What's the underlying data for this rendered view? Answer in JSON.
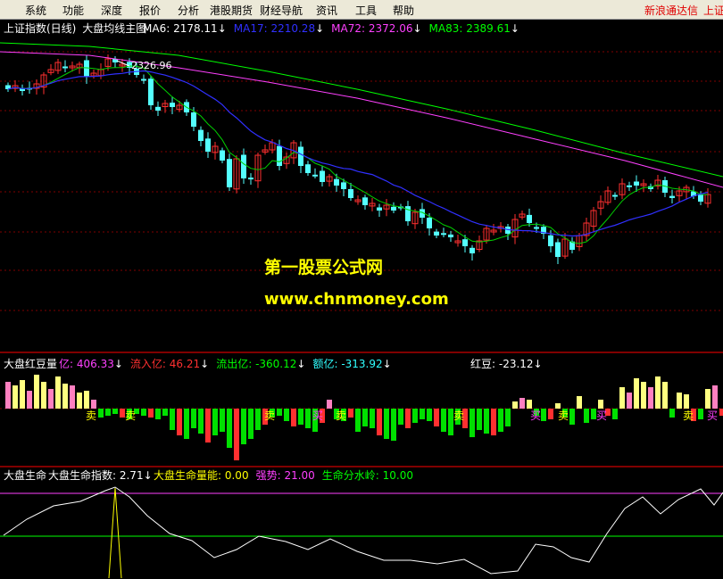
{
  "menu": {
    "items": [
      "系统",
      "功能",
      "深度",
      "报价",
      "分析",
      "港股期货",
      "财经导航",
      "资讯",
      "工具",
      "帮助"
    ],
    "brand": "新浪通达信",
    "brand_cut": "上证"
  },
  "main_panel": {
    "index_name": "上证指数(日线)",
    "formula_name": "大盘均线主图",
    "ma": [
      {
        "label": "MA6: ",
        "value": "2178.11",
        "color": "#ffffff"
      },
      {
        "label": "MA17: ",
        "value": "2210.28",
        "color": "#3030ff"
      },
      {
        "label": "MA72: ",
        "value": "2372.06",
        "color": "#ff40ff"
      },
      {
        "label": "MA83: ",
        "value": "2389.61",
        "color": "#00ff00"
      }
    ],
    "high_marker": "2326.96",
    "watermark_title": "第一股票公式网",
    "watermark_url": "www.chnmoney.com"
  },
  "mid_panel": {
    "name": "大盘红豆量",
    "items": [
      {
        "label": "亿: ",
        "value": "406.33",
        "color": "#ff40ff"
      },
      {
        "label": "流入亿: ",
        "value": "46.21",
        "color": "#ff3030"
      },
      {
        "label": "流出亿: ",
        "value": "-360.12",
        "color": "#00ff00"
      },
      {
        "label": "额亿: ",
        "value": "-313.92",
        "color": "#30ffff"
      },
      {
        "label": "红豆: ",
        "value": "-23.12",
        "color": "#ffffff"
      }
    ],
    "buy_label": "买",
    "sell_label": "卖"
  },
  "bottom_panel": {
    "name": "大盘生命",
    "items": [
      {
        "label": "大盘生命指数: ",
        "value": "2.71",
        "color": "#ffffff"
      },
      {
        "label": "大盘生命量能: ",
        "value": "0.00",
        "color": "#ffff00"
      },
      {
        "label": "强势: ",
        "value": "21.00",
        "color": "#ff40ff"
      },
      {
        "label": "生命分水岭: ",
        "value": "10.00",
        "color": "#00ff00"
      }
    ]
  },
  "arrow_down": "↓",
  "colors": {
    "up": "#ff3030",
    "down": "#54ffff",
    "grid": "#800000",
    "panel_border": "#ff0000"
  }
}
